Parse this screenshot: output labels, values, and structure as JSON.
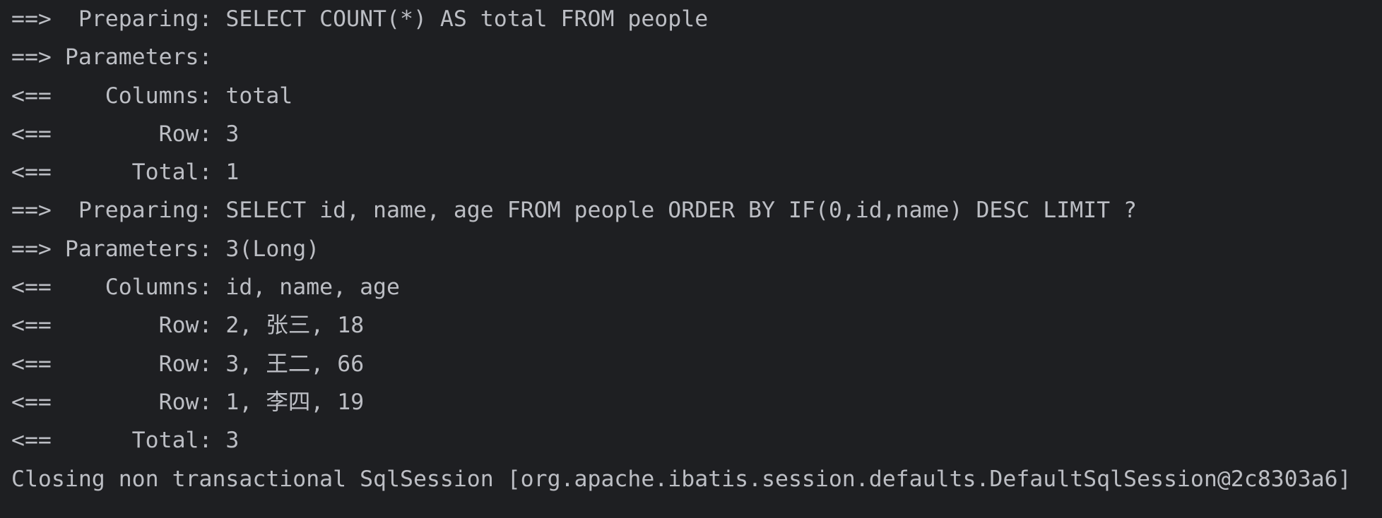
{
  "console": {
    "lines": [
      "==>  Preparing: SELECT COUNT(*) AS total FROM people",
      "==> Parameters: ",
      "<==    Columns: total",
      "<==        Row: 3",
      "<==      Total: 1",
      "==>  Preparing: SELECT id, name, age FROM people ORDER BY IF(0,id,name) DESC LIMIT ?",
      "==> Parameters: 3(Long)",
      "<==    Columns: id, name, age",
      "<==        Row: 2, 张三, 18",
      "<==        Row: 3, 王二, 66",
      "<==        Row: 1, 李四, 19",
      "<==      Total: 3",
      "Closing non transactional SqlSession [org.apache.ibatis.session.defaults.DefaultSqlSession@2c8303a6]"
    ],
    "colors": {
      "background": "#1e1f22",
      "text": "#bcbec4"
    }
  }
}
